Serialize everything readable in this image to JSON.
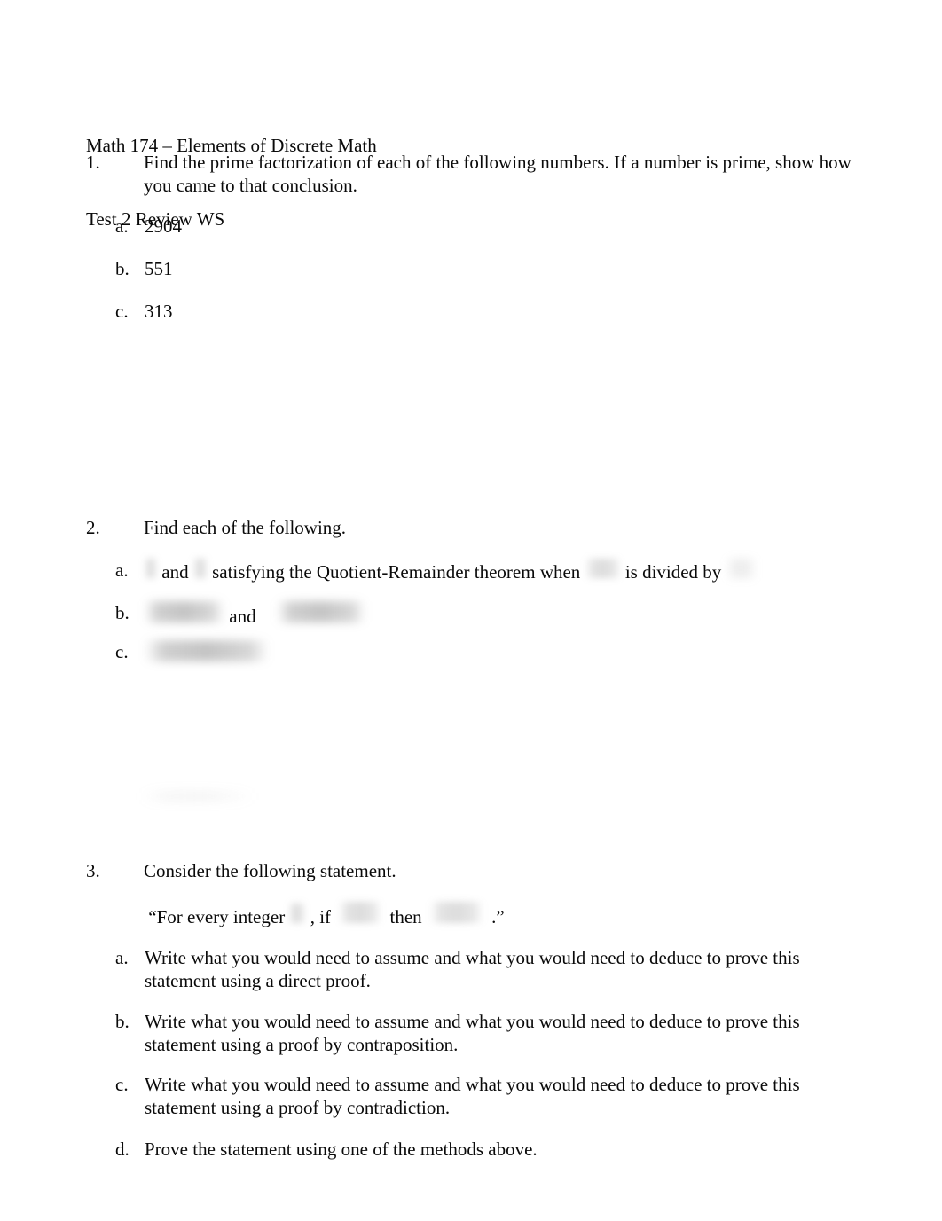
{
  "document": {
    "header_line_1": "Math 174 – Elements of Discrete Math",
    "header_line_2": "Test 2 Review WS"
  },
  "questions": [
    {
      "number": "1.",
      "prompt": "Find the prime factorization of each of the following numbers.  If a number is prime, show how you came to that conclusion.",
      "items": [
        {
          "letter": "a.",
          "text": "2904"
        },
        {
          "letter": "b.",
          "text": "551"
        },
        {
          "letter": "c.",
          "text": "313"
        }
      ]
    },
    {
      "number": "2.",
      "prompt": "Find each of the following.",
      "items": [
        {
          "letter": "a.",
          "fragments": {
            "f1": "and",
            "f2": "satisfying the Quotient-Remainder theorem when",
            "f3": "is divided by"
          }
        },
        {
          "letter": "b.",
          "fragments": {
            "f1": "and"
          }
        },
        {
          "letter": "c.",
          "fragments": {}
        }
      ]
    },
    {
      "number": "3.",
      "prompt": "Consider the following statement.",
      "statement": {
        "open_quote": "“For every integer",
        "comma_if": ", if",
        "then": "then",
        "close": ".”"
      },
      "items": [
        {
          "letter": "a.",
          "text": "Write what you would need to assume and what you would need to deduce to prove this statement using a direct proof."
        },
        {
          "letter": "b.",
          "text": "Write what you would need to assume and what you would need to deduce to prove this statement using a proof by contraposition."
        },
        {
          "letter": "c.",
          "text": "Write what you would need to assume and what you would need to deduce to prove this statement using a proof by contradiction."
        },
        {
          "letter": "d.",
          "text": "Prove the statement using one of the methods above."
        }
      ]
    }
  ]
}
